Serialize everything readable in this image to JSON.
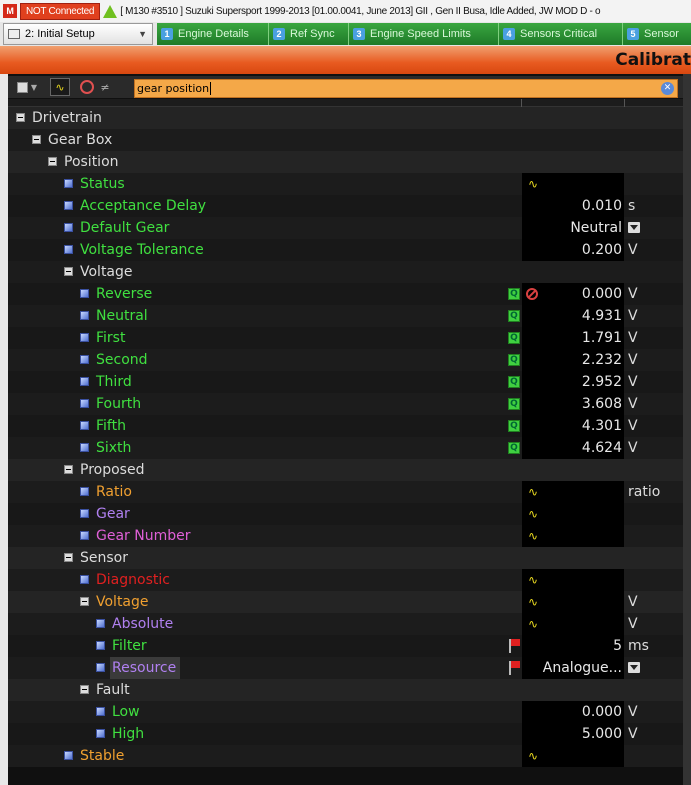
{
  "titlebar": {
    "status": "NOT Connected",
    "title": "[ M130 #3510 ]  Suzuki Supersport 1999-2013 [01.00.0041, June 2013] GII , Gen II Busa, Idle Added, JW MOD D - o"
  },
  "workbook": {
    "selected": "2: Initial Setup"
  },
  "tabs": [
    {
      "num": "1",
      "label": "Engine Details"
    },
    {
      "num": "2",
      "label": "Ref Sync"
    },
    {
      "num": "3",
      "label": "Engine Speed Limits"
    },
    {
      "num": "4",
      "label": "Sensors Critical"
    },
    {
      "num": "5",
      "label": "Sensor"
    }
  ],
  "banner": {
    "title": "Calibrat"
  },
  "search": {
    "value": "gear position"
  },
  "tree": [
    {
      "label": "Drivetrain",
      "level": 0,
      "group": true,
      "color": "white"
    },
    {
      "label": "Gear Box",
      "level": 1,
      "group": true,
      "color": "white"
    },
    {
      "label": "Position",
      "level": 2,
      "group": true,
      "color": "white"
    },
    {
      "label": "Status",
      "level": 3,
      "color": "green",
      "wave": true
    },
    {
      "label": "Acceptance Delay",
      "level": 3,
      "color": "green",
      "value": "0.010",
      "unit": "s"
    },
    {
      "label": "Default Gear",
      "level": 3,
      "color": "green",
      "value": "Neutral",
      "dropdown": true
    },
    {
      "label": "Voltage Tolerance",
      "level": 3,
      "color": "green",
      "value": "0.200",
      "unit": "V"
    },
    {
      "label": "Voltage",
      "level": 3,
      "group": true,
      "color": "white"
    },
    {
      "label": "Reverse",
      "level": 4,
      "color": "green",
      "q": true,
      "error": true,
      "value": "0.000",
      "unit": "V"
    },
    {
      "label": "Neutral",
      "level": 4,
      "color": "green",
      "q": true,
      "value": "4.931",
      "unit": "V"
    },
    {
      "label": "First",
      "level": 4,
      "color": "green",
      "q": true,
      "value": "1.791",
      "unit": "V"
    },
    {
      "label": "Second",
      "level": 4,
      "color": "green",
      "q": true,
      "value": "2.232",
      "unit": "V"
    },
    {
      "label": "Third",
      "level": 4,
      "color": "green",
      "q": true,
      "value": "2.952",
      "unit": "V"
    },
    {
      "label": "Fourth",
      "level": 4,
      "color": "green",
      "q": true,
      "value": "3.608",
      "unit": "V"
    },
    {
      "label": "Fifth",
      "level": 4,
      "color": "green",
      "q": true,
      "value": "4.301",
      "unit": "V"
    },
    {
      "label": "Sixth",
      "level": 4,
      "color": "green",
      "q": true,
      "value": "4.624",
      "unit": "V"
    },
    {
      "label": "Proposed",
      "level": 3,
      "group": true,
      "color": "white"
    },
    {
      "label": "Ratio",
      "level": 4,
      "color": "orange",
      "wave": true,
      "unit": "ratio"
    },
    {
      "label": "Gear",
      "level": 4,
      "color": "purple",
      "wave": true
    },
    {
      "label": "Gear Number",
      "level": 4,
      "color": "pink",
      "wave": true
    },
    {
      "label": "Sensor",
      "level": 3,
      "group": true,
      "color": "white"
    },
    {
      "label": "Diagnostic",
      "level": 4,
      "color": "red",
      "wave": true
    },
    {
      "label": "Voltage",
      "level": 4,
      "group": true,
      "color": "orange",
      "wave": true,
      "unit": "V"
    },
    {
      "label": "Absolute",
      "level": 5,
      "color": "purple",
      "wave": true,
      "unit": "V"
    },
    {
      "label": "Filter",
      "level": 5,
      "color": "green",
      "flag": true,
      "value": "5",
      "unit": "ms"
    },
    {
      "label": "Resource",
      "level": 5,
      "color": "purple",
      "flag": true,
      "value": "Analogue...",
      "dropdown": true,
      "selected": true
    },
    {
      "label": "Fault",
      "level": 4,
      "group": true,
      "color": "white"
    },
    {
      "label": "Low",
      "level": 5,
      "color": "green",
      "value": "0.000",
      "unit": "V"
    },
    {
      "label": "High",
      "level": 5,
      "color": "green",
      "value": "5.000",
      "unit": "V"
    },
    {
      "label": "Stable",
      "level": 3,
      "color": "orange",
      "wave": true
    }
  ]
}
